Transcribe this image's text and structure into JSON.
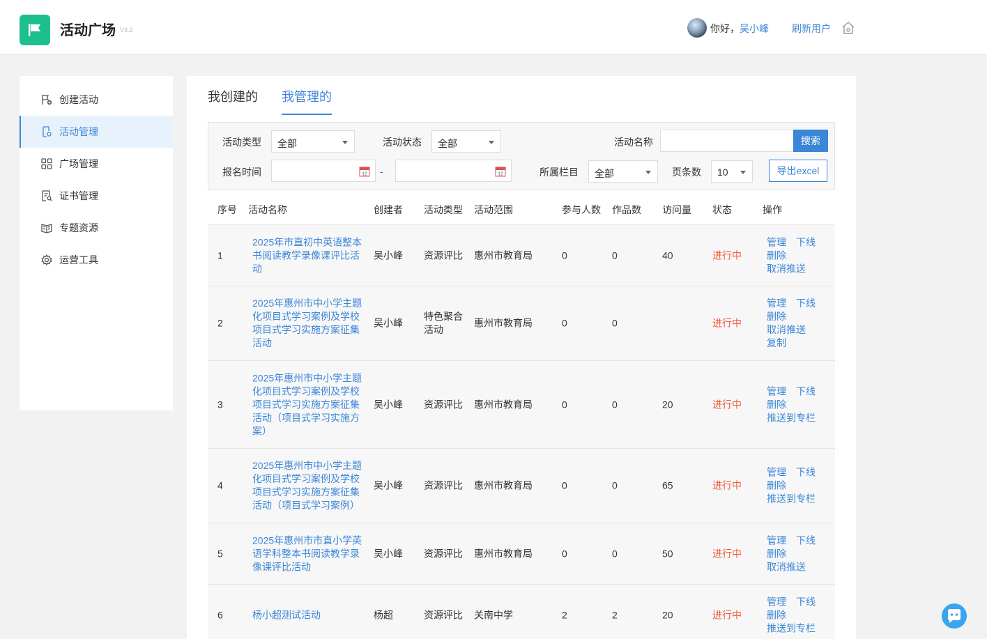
{
  "header": {
    "app_title": "活动广场",
    "version": "V3.2",
    "greeting": "你好，",
    "username": "吴小峰",
    "refresh_user": "刷新用户"
  },
  "sidebar": {
    "items": [
      {
        "label": "创建活动",
        "icon": "flag-add-icon",
        "active": false
      },
      {
        "label": "活动管理",
        "icon": "doc-gear-icon",
        "active": true
      },
      {
        "label": "广场管理",
        "icon": "grid-icon",
        "active": false
      },
      {
        "label": "证书管理",
        "icon": "certificate-icon",
        "active": false
      },
      {
        "label": "专题资源",
        "icon": "book-icon",
        "active": false
      },
      {
        "label": "运营工具",
        "icon": "gear-icon",
        "active": false
      }
    ]
  },
  "tabs": {
    "created": "我创建的",
    "managed": "我管理的"
  },
  "filters": {
    "type_label": "活动类型",
    "type_value": "全部",
    "status_label": "活动状态",
    "status_value": "全部",
    "name_label": "活动名称",
    "name_value": "",
    "search_button": "搜索",
    "signup_time_label": "报名时间",
    "date_icon_day": "12",
    "range_separator": "-",
    "column_label": "所属栏目",
    "column_value": "全部",
    "page_size_label": "页条数",
    "page_size_value": "10",
    "export_button": "导出excel"
  },
  "table": {
    "headers": {
      "index": "序号",
      "name": "活动名称",
      "creator": "创建者",
      "type": "活动类型",
      "scope": "活动范围",
      "participants": "参与人数",
      "works": "作品数",
      "visits": "访问量",
      "status": "状态",
      "actions": "操作"
    },
    "rows": [
      {
        "index": "1",
        "name": "2025年市直初中英语整本书阅读教学录像课评比活动",
        "creator": "吴小峰",
        "type": "资源评比",
        "scope": "惠州市教育局",
        "participants": "0",
        "works": "0",
        "visits": "40",
        "status": "进行中",
        "ops": {
          "manage": "管理",
          "offline": "下线",
          "delete": "删除",
          "push": "取消推送"
        }
      },
      {
        "index": "2",
        "name": "2025年惠州市中小学主题化项目式学习案例及学校项目式学习实施方案征集活动",
        "creator": "吴小峰",
        "type": "特色聚合活动",
        "scope": "惠州市教育局",
        "participants": "0",
        "works": "0",
        "visits": "",
        "status": "进行中",
        "ops": {
          "manage": "管理",
          "offline": "下线",
          "delete": "删除",
          "push": "取消推送",
          "copy": "复制"
        }
      },
      {
        "index": "3",
        "name": "2025年惠州市中小学主题化项目式学习案例及学校项目式学习实施方案征集活动（项目式学习实施方案）",
        "creator": "吴小峰",
        "type": "资源评比",
        "scope": "惠州市教育局",
        "participants": "0",
        "works": "0",
        "visits": "20",
        "status": "进行中",
        "ops": {
          "manage": "管理",
          "offline": "下线",
          "delete": "删除",
          "push": "推送到专栏"
        }
      },
      {
        "index": "4",
        "name": "2025年惠州市中小学主题化项目式学习案例及学校项目式学习实施方案征集活动（项目式学习案例）",
        "creator": "吴小峰",
        "type": "资源评比",
        "scope": "惠州市教育局",
        "participants": "0",
        "works": "0",
        "visits": "65",
        "status": "进行中",
        "ops": {
          "manage": "管理",
          "offline": "下线",
          "delete": "删除",
          "push": "推送到专栏"
        }
      },
      {
        "index": "5",
        "name": "2025年惠州市市直小学英语学科整本书阅读教学录像课评比活动",
        "creator": "吴小峰",
        "type": "资源评比",
        "scope": "惠州市教育局",
        "participants": "0",
        "works": "0",
        "visits": "50",
        "status": "进行中",
        "ops": {
          "manage": "管理",
          "offline": "下线",
          "delete": "删除",
          "push": "取消推送"
        }
      },
      {
        "index": "6",
        "name": "杨小超测试活动",
        "creator": "杨超",
        "type": "资源评比",
        "scope": "关南中学",
        "participants": "2",
        "works": "2",
        "visits": "20",
        "status": "进行中",
        "ops": {
          "manage": "管理",
          "offline": "下线",
          "delete": "删除",
          "push": "推送到专栏"
        }
      }
    ]
  },
  "colors": {
    "accent": "#3b86d8",
    "brand": "#1dc08d",
    "status_active": "#f05a3c"
  }
}
